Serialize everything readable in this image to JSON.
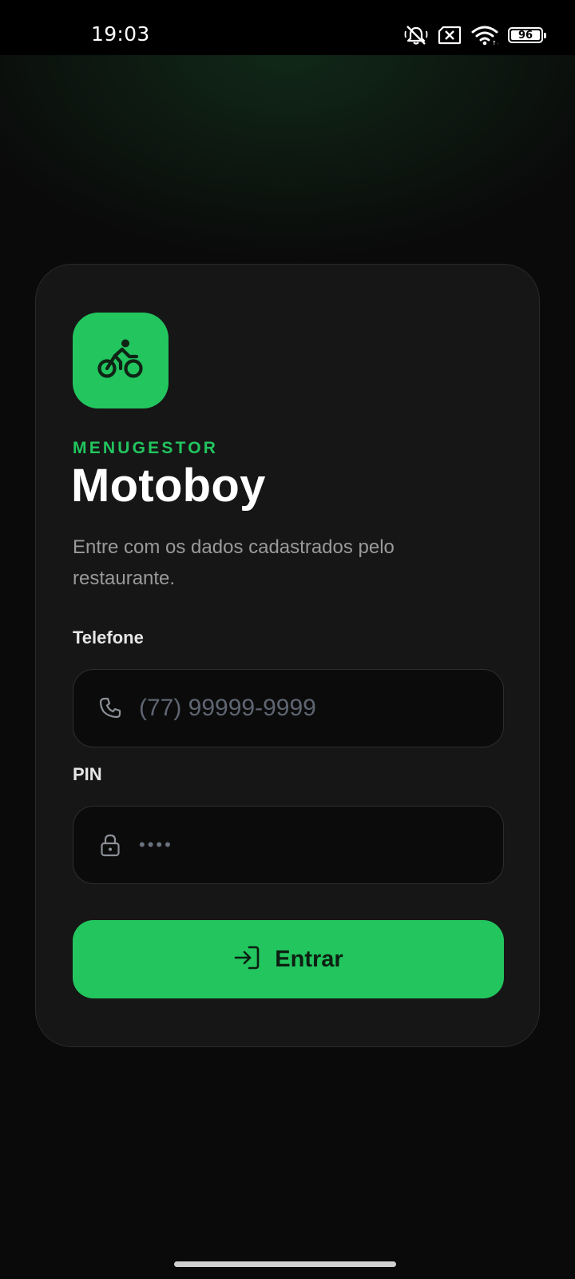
{
  "status_bar": {
    "time": "19:03",
    "battery": "96",
    "icons": [
      "mute-icon",
      "no-sim-icon",
      "wifi-icon",
      "battery-icon"
    ]
  },
  "brand": {
    "label": "MENUGESTOR",
    "logo_icon": "bike-icon",
    "accent_color": "#22c55e"
  },
  "title": "Motoboy",
  "subtitle": "Entre com os dados cadastrados pelo restaurante.",
  "form": {
    "phone": {
      "label": "Telefone",
      "placeholder": "(77) 99999-9999",
      "icon": "phone-icon"
    },
    "pin": {
      "label": "PIN",
      "placeholder": "••••",
      "icon": "lock-icon"
    },
    "submit": {
      "label": "Entrar",
      "icon": "login-icon"
    }
  }
}
